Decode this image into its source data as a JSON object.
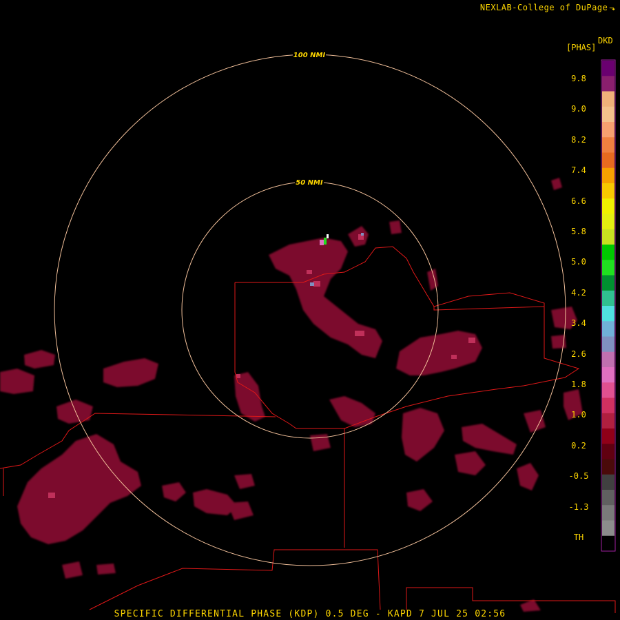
{
  "credit": {
    "text": "NEXLAB-College of DuPage",
    "logo_icon": "cod-logo-icon"
  },
  "footer": {
    "caption": "SPECIFIC DIFFERENTIAL PHASE (KDP) 0.5 DEG - KAPD 7 JUL 25 02:56"
  },
  "range_rings": [
    {
      "label": "50 NMI"
    },
    {
      "label": "100 NMI"
    }
  ],
  "legend": {
    "product": "DKD",
    "unit": "[PHAS]",
    "ticks": [
      "9.8",
      "9.0",
      "8.2",
      "7.4",
      "6.6",
      "5.8",
      "5.0",
      "4.2",
      "3.4",
      "2.6",
      "1.8",
      "1.0",
      "0.2",
      "-0.5",
      "-1.3",
      "TH"
    ],
    "colors": [
      "#6a0070",
      "#8a1f6e",
      "#f0b07a",
      "#f4c08c",
      "#f7a070",
      "#f08040",
      "#e86a20",
      "#f7a000",
      "#f8c800",
      "#f0f000",
      "#e4ee10",
      "#c8e020",
      "#00c800",
      "#20e020",
      "#009030",
      "#30c090",
      "#50e0e0",
      "#70b0d8",
      "#8090c0",
      "#c070b0",
      "#e070c0",
      "#e05090",
      "#d03060",
      "#b01f3f",
      "#900018",
      "#600010",
      "#4a0a0a",
      "#404040",
      "#606060",
      "#7a7a7a",
      "#8c8c8c",
      "#000000"
    ]
  },
  "colors": {
    "ring": "#f2c09a",
    "border": "#e01818",
    "echo": "#8a1030",
    "echo_bright": "#c0305a",
    "text": "#ffd700"
  }
}
